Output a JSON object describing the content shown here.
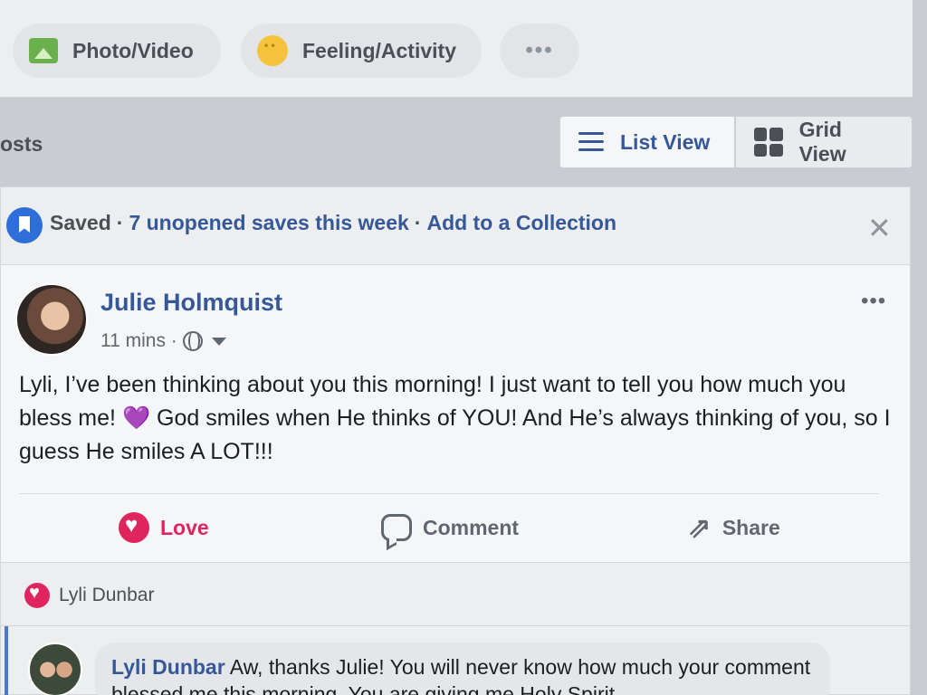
{
  "composer": {
    "photo_label": "Photo/Video",
    "feeling_label": "Feeling/Activity",
    "more_label": "•••"
  },
  "views": {
    "posts_label": "osts",
    "list_label": "List View",
    "grid_label": "Grid View"
  },
  "saved_banner": {
    "saved": "Saved",
    "unopened": "7 unopened saves this week",
    "add": "Add to a Collection",
    "close": "✕"
  },
  "post": {
    "author": "Julie Holmquist",
    "time": "11 mins ·",
    "menu": "•••",
    "body_part1": "Lyli, I’ve been thinking about you this morning! I just want to tell you how much you bless me! ",
    "heart": "💜",
    "body_part2": " God smiles when He thinks of YOU! And He’s always thinking of you, so I guess He smiles A LOT!!!",
    "actions": {
      "love": "Love",
      "comment": "Comment",
      "share": "Share"
    }
  },
  "reactions": {
    "name": "Lyli Dunbar"
  },
  "comment": {
    "author": "Lyli Dunbar",
    "text": " Aw, thanks Julie! You will never know how much your comment blessed me this morning. You are giving me Holy Spirit"
  },
  "colors": {
    "link": "#365899",
    "love": "#e0245e",
    "saved_icon": "#2d6ed9",
    "heart_emoji": "#7b4ab8"
  }
}
